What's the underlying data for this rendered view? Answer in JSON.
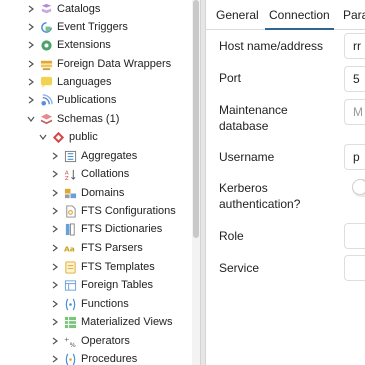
{
  "tree": {
    "items": [
      {
        "label": "Catalogs",
        "icon": "catalog-icon"
      },
      {
        "label": "Event Triggers",
        "icon": "event-trigger-icon"
      },
      {
        "label": "Extensions",
        "icon": "extension-icon"
      },
      {
        "label": "Foreign Data Wrappers",
        "icon": "foreign-data-wrapper-icon"
      },
      {
        "label": "Languages",
        "icon": "language-icon"
      },
      {
        "label": "Publications",
        "icon": "publication-icon"
      },
      {
        "label": "Schemas (1)",
        "icon": "schema-icon"
      },
      {
        "label": "public",
        "icon": "schema-public-icon"
      },
      {
        "label": "Aggregates",
        "icon": "aggregate-icon"
      },
      {
        "label": "Collations",
        "icon": "collation-icon"
      },
      {
        "label": "Domains",
        "icon": "domain-icon"
      },
      {
        "label": "FTS Configurations",
        "icon": "fts-configuration-icon"
      },
      {
        "label": "FTS Dictionaries",
        "icon": "fts-dictionary-icon"
      },
      {
        "label": "FTS Parsers",
        "icon": "fts-parser-icon"
      },
      {
        "label": "FTS Templates",
        "icon": "fts-template-icon"
      },
      {
        "label": "Foreign Tables",
        "icon": "foreign-table-icon"
      },
      {
        "label": "Functions",
        "icon": "function-icon"
      },
      {
        "label": "Materialized Views",
        "icon": "materialized-view-icon"
      },
      {
        "label": "Operators",
        "icon": "operator-icon"
      },
      {
        "label": "Procedures",
        "icon": "procedure-icon"
      }
    ]
  },
  "tabs": [
    {
      "label": "General"
    },
    {
      "label": "Connection"
    },
    {
      "label": "Para"
    }
  ],
  "active_tab": "Connection",
  "form": {
    "host_label": "Host name/address",
    "host_value": "rr",
    "port_label": "Port",
    "port_value": "5",
    "maintenance_label": "Maintenance database",
    "maintenance_value": "M",
    "username_label": "Username",
    "username_value": "p",
    "kerberos_label": "Kerberos authentication?",
    "kerberos_enabled": false,
    "role_label": "Role",
    "role_value": "",
    "service_label": "Service",
    "service_value": ""
  },
  "colors": {
    "accent": "#326690",
    "schema_red": "#c0392b",
    "tree_chevron": "#555555"
  }
}
